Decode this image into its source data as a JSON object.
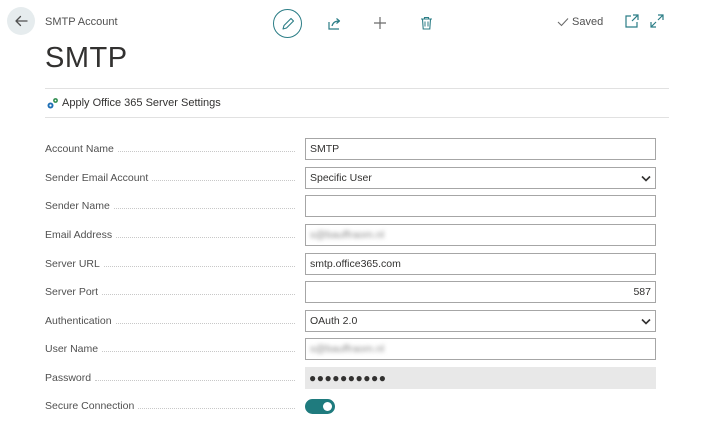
{
  "header": {
    "caption": "SMTP Account",
    "title": "SMTP",
    "status": "Saved"
  },
  "toolbar": {
    "icons": [
      "back-arrow-icon",
      "edit-icon",
      "share-icon",
      "plus-icon",
      "trash-icon",
      "checkmark-icon",
      "popout-icon",
      "expand-icon"
    ]
  },
  "actions": {
    "apply_label": "Apply Office 365 Server Settings"
  },
  "fields": {
    "account_name": {
      "label": "Account Name",
      "value": "SMTP"
    },
    "sender_email_account": {
      "label": "Sender Email Account",
      "value": "Specific User"
    },
    "sender_name": {
      "label": "Sender Name",
      "value": ""
    },
    "email_address": {
      "label": "Email Address",
      "value": "s@bauffraom.nl"
    },
    "server_url": {
      "label": "Server URL",
      "value": "smtp.office365.com"
    },
    "server_port": {
      "label": "Server Port",
      "value": "587"
    },
    "authentication": {
      "label": "Authentication",
      "value": "OAuth 2.0"
    },
    "user_name": {
      "label": "User Name",
      "value": "s@bauffraom.nl"
    },
    "password": {
      "label": "Password",
      "value": "●●●●●●●●●●"
    },
    "secure_connection": {
      "label": "Secure Connection",
      "enabled": true
    }
  },
  "colors": {
    "accent": "#1f7b7e",
    "back_button_bg": "#e6ecee",
    "readonly_bg": "#e8e8e8"
  }
}
